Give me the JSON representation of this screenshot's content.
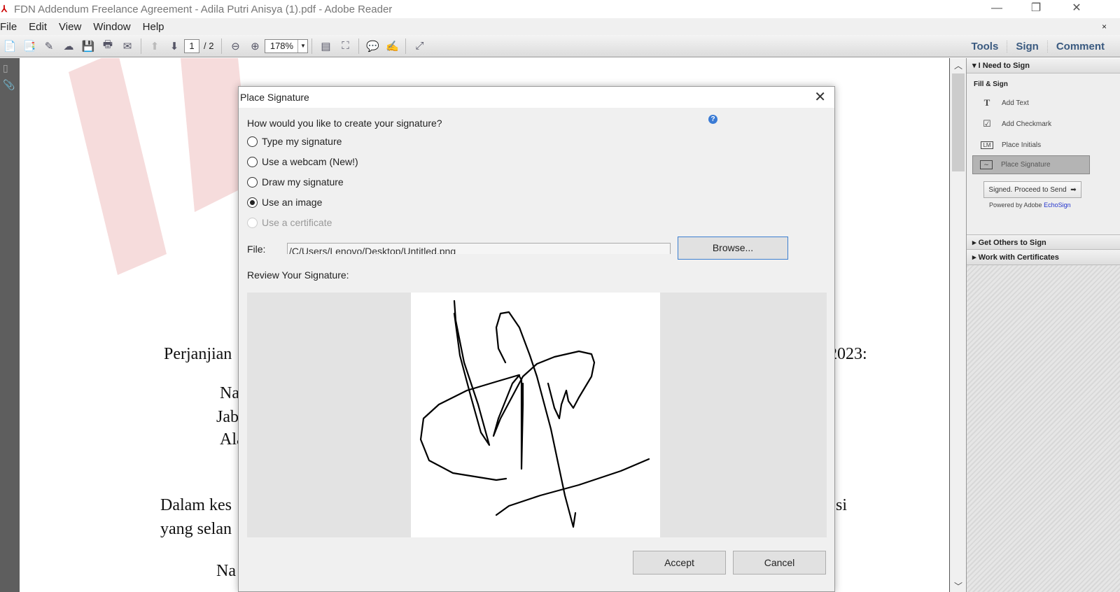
{
  "window": {
    "title": "FDN Addendum Freelance Agreement - Adila Putri Anisya (1).pdf - Adobe Reader",
    "minimize": "—",
    "restore": "❐",
    "close": "✕"
  },
  "menu": {
    "items": [
      "File",
      "Edit",
      "View",
      "Window",
      "Help"
    ],
    "close_doc": "×"
  },
  "toolbar": {
    "page_current": "1",
    "page_total": "/ 2",
    "zoom": "178%",
    "tabs": [
      "Tools",
      "Sign",
      "Comment"
    ]
  },
  "document": {
    "lines": [
      "Perjanjian",
      "2023:",
      "Na",
      "Jab",
      "Ala",
      "Dalam kes",
      "si",
      "yang selan",
      "Na"
    ]
  },
  "right_panel": {
    "section_open": "I Need to Sign",
    "subheading": "Fill & Sign",
    "items": [
      {
        "label": "Add Text",
        "icon": "text-T-icon"
      },
      {
        "label": "Add Checkmark",
        "icon": "checkmark-icon"
      },
      {
        "label": "Place Initials",
        "icon": "initials-icon"
      },
      {
        "label": "Place Signature",
        "icon": "signature-icon",
        "active": true
      }
    ],
    "send_button": "Signed. Proceed to Send",
    "powered_prefix": "Powered by Adobe ",
    "powered_link": "EchoSign",
    "collapsed_sections": [
      "Get Others to Sign",
      "Work with Certificates"
    ]
  },
  "dialog": {
    "title": "Place Signature",
    "question": "How would you like to create your signature?",
    "options": [
      {
        "label": "Type my signature",
        "selected": false,
        "enabled": true
      },
      {
        "label": "Use a webcam (New!)",
        "selected": false,
        "enabled": true
      },
      {
        "label": "Draw my signature",
        "selected": false,
        "enabled": true
      },
      {
        "label": "Use an image",
        "selected": true,
        "enabled": true
      },
      {
        "label": "Use a certificate",
        "selected": false,
        "enabled": false
      }
    ],
    "file_label": "File:",
    "file_value": "/C/Users/Lenovo/Desktop/Untitled.png",
    "browse": "Browse...",
    "review_label": "Review Your Signature:",
    "accept": "Accept",
    "cancel": "Cancel"
  }
}
